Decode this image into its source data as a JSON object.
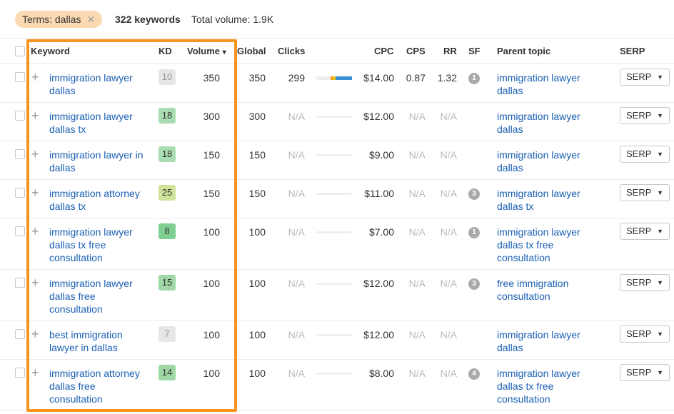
{
  "filter": {
    "chip_label": "Terms: dallas",
    "close_glyph": "✕"
  },
  "summary": {
    "keywords": "322 keywords",
    "total_volume": "Total volume: 1.9K"
  },
  "columns": {
    "keyword": "Keyword",
    "kd": "KD",
    "volume": "Volume",
    "sort_glyph": "▾",
    "global": "Global",
    "clicks": "Clicks",
    "cpc": "CPC",
    "cps": "CPS",
    "rr": "RR",
    "sf": "SF",
    "parent_topic": "Parent topic",
    "serp": "SERP"
  },
  "serp_button_label": "SERP",
  "serp_caret": "▼",
  "plus_glyph": "+",
  "kd_colors": {
    "gray": "#e6e6e6",
    "green_light": "#a9dcb0",
    "green_mid": "#9fd8a6",
    "yellow": "#cfe49a",
    "green": "#7fcf91"
  },
  "highlight_color": "#f7931e",
  "rows": [
    {
      "keyword": "immigration lawyer dallas",
      "kd": "10",
      "kd_color": "#e6e6e6",
      "kd_text": "#999",
      "volume": "350",
      "global": "350",
      "clicks": "299",
      "clicks_na": false,
      "cpc": "$14.00",
      "cps": "0.87",
      "rr": "1.32",
      "sf": "1",
      "parent_topic": "immigration lawyer dallas"
    },
    {
      "keyword": "immigration lawyer dallas tx",
      "kd": "18",
      "kd_color": "#a9dcb0",
      "kd_text": "#333",
      "volume": "300",
      "global": "300",
      "clicks": "N/A",
      "clicks_na": true,
      "cpc": "$12.00",
      "cps": "N/A",
      "rr": "N/A",
      "sf": "",
      "parent_topic": "immigration lawyer dallas"
    },
    {
      "keyword": "immigration lawyer in dallas",
      "kd": "18",
      "kd_color": "#a9dcb0",
      "kd_text": "#333",
      "volume": "150",
      "global": "150",
      "clicks": "N/A",
      "clicks_na": true,
      "cpc": "$9.00",
      "cps": "N/A",
      "rr": "N/A",
      "sf": "",
      "parent_topic": "immigration lawyer dallas"
    },
    {
      "keyword": "immigration attorney dallas tx",
      "kd": "25",
      "kd_color": "#cfe49a",
      "kd_text": "#333",
      "volume": "150",
      "global": "150",
      "clicks": "N/A",
      "clicks_na": true,
      "cpc": "$11.00",
      "cps": "N/A",
      "rr": "N/A",
      "sf": "3",
      "parent_topic": "immigration lawyer dallas tx"
    },
    {
      "keyword": "immigration lawyer dallas tx free consultation",
      "kd": "8",
      "kd_color": "#7fcf91",
      "kd_text": "#333",
      "volume": "100",
      "global": "100",
      "clicks": "N/A",
      "clicks_na": true,
      "cpc": "$7.00",
      "cps": "N/A",
      "rr": "N/A",
      "sf": "1",
      "parent_topic": "immigration lawyer dallas tx free consultation"
    },
    {
      "keyword": "immigration lawyer dallas free consultation",
      "kd": "15",
      "kd_color": "#9fd8a6",
      "kd_text": "#333",
      "volume": "100",
      "global": "100",
      "clicks": "N/A",
      "clicks_na": true,
      "cpc": "$12.00",
      "cps": "N/A",
      "rr": "N/A",
      "sf": "3",
      "parent_topic": "free immigration consultation"
    },
    {
      "keyword": "best immigration lawyer in dallas",
      "kd": "7",
      "kd_color": "#e6e6e6",
      "kd_text": "#999",
      "volume": "100",
      "global": "100",
      "clicks": "N/A",
      "clicks_na": true,
      "cpc": "$12.00",
      "cps": "N/A",
      "rr": "N/A",
      "sf": "",
      "parent_topic": "immigration lawyer dallas"
    },
    {
      "keyword": "immigration attorney dallas free consultation",
      "kd": "14",
      "kd_color": "#9fd8a6",
      "kd_text": "#333",
      "volume": "100",
      "global": "100",
      "clicks": "N/A",
      "clicks_na": true,
      "cpc": "$8.00",
      "cps": "N/A",
      "rr": "N/A",
      "sf": "4",
      "parent_topic": "immigration lawyer dallas tx free consultation"
    }
  ]
}
